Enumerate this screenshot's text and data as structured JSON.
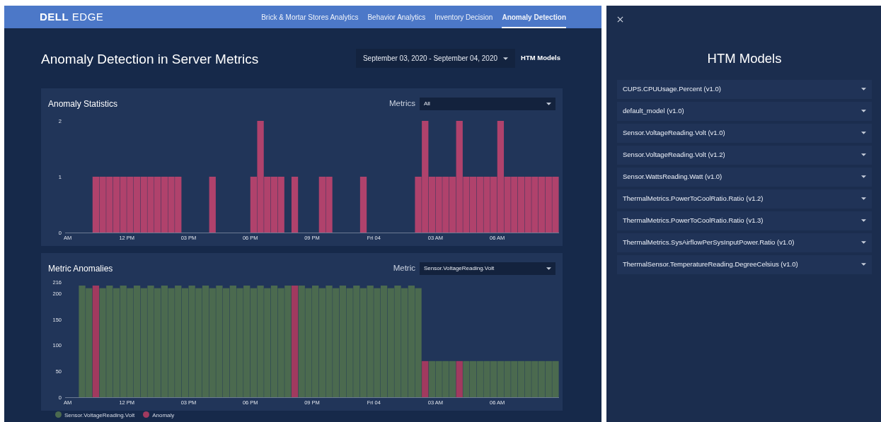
{
  "navbar": {
    "logo": {
      "brand": "DELL",
      "product": "EDGE"
    },
    "links": [
      {
        "label": "Brick & Mortar Stores Analytics",
        "selected": false
      },
      {
        "label": "Behavior Analytics",
        "selected": false
      },
      {
        "label": "Inventory Decision",
        "selected": false
      },
      {
        "label": "Anomaly Detection",
        "selected": true
      }
    ]
  },
  "page_title": "Anomaly Detection in Server Metrics",
  "date_range": {
    "value": "September 03, 2020 - September 04, 2020"
  },
  "htm_models_button": "HTM Models",
  "cards": [
    {
      "title": "Anomaly Statistics",
      "filter": {
        "label": "Metrics",
        "value": "All"
      },
      "chart_data": {
        "type": "bar",
        "categories": [
          "AM",
          null,
          null,
          null,
          null,
          null,
          null,
          null,
          null,
          "12 PM",
          null,
          null,
          null,
          null,
          null,
          null,
          null,
          null,
          "03 PM",
          null,
          null,
          null,
          null,
          null,
          null,
          null,
          null,
          "06 PM",
          null,
          null,
          null,
          null,
          null,
          null,
          null,
          null,
          "09 PM",
          null,
          null,
          null,
          null,
          null,
          null,
          null,
          null,
          "Fri 04",
          null,
          null,
          null,
          null,
          null,
          null,
          null,
          null,
          "03 AM",
          null,
          null,
          null,
          null,
          null,
          null,
          null,
          null,
          "06 AM",
          null,
          null,
          null,
          null,
          null,
          null,
          null,
          null
        ],
        "values": [
          0,
          0,
          0,
          0,
          1,
          1,
          1,
          1,
          1,
          1,
          1,
          1,
          1,
          1,
          1,
          1,
          1,
          0,
          0,
          0,
          0,
          1,
          0,
          0,
          0,
          0,
          0,
          1,
          2,
          1,
          1,
          1,
          0,
          1,
          0,
          0,
          0,
          1,
          1,
          0,
          0,
          0,
          0,
          1,
          0,
          0,
          0,
          0,
          0,
          0,
          0,
          1,
          2,
          1,
          1,
          1,
          1,
          2,
          1,
          1,
          1,
          1,
          1,
          2,
          1,
          1,
          1,
          1,
          1,
          1,
          1,
          1
        ],
        "ylim": [
          0,
          2
        ],
        "yticks": [
          0,
          1,
          2
        ]
      }
    },
    {
      "title": "Metric Anomalies",
      "filter": {
        "label": "Metric",
        "value": "Sensor.VoltageReading.Volt"
      },
      "chart_data": {
        "type": "bar",
        "categories": [
          "AM",
          null,
          null,
          null,
          null,
          null,
          null,
          null,
          null,
          "12 PM",
          null,
          null,
          null,
          null,
          null,
          null,
          null,
          null,
          "03 PM",
          null,
          null,
          null,
          null,
          null,
          null,
          null,
          null,
          "06 PM",
          null,
          null,
          null,
          null,
          null,
          null,
          null,
          null,
          "09 PM",
          null,
          null,
          null,
          null,
          null,
          null,
          null,
          null,
          "Fri 04",
          null,
          null,
          null,
          null,
          null,
          null,
          null,
          null,
          "03 AM",
          null,
          null,
          null,
          null,
          null,
          null,
          null,
          null,
          "06 AM",
          null,
          null,
          null,
          null,
          null,
          null,
          null,
          null
        ],
        "series": [
          {
            "name": "Sensor.VoltageReading.Volt",
            "color": "#4b6a4f",
            "values": [
              null,
              null,
              216,
              211,
              null,
              211,
              216,
              211,
              216,
              211,
              216,
              211,
              216,
              211,
              216,
              211,
              216,
              211,
              216,
              211,
              216,
              211,
              216,
              211,
              216,
              211,
              216,
              211,
              216,
              211,
              216,
              211,
              216,
              null,
              216,
              211,
              216,
              211,
              216,
              211,
              216,
              211,
              216,
              211,
              216,
              211,
              216,
              211,
              216,
              211,
              216,
              211,
              null,
              70,
              70,
              70,
              70,
              null,
              70,
              70,
              70,
              70,
              70,
              70,
              70,
              70,
              70,
              70,
              70,
              70,
              70,
              70
            ]
          },
          {
            "name": "Anomaly",
            "color": "#a13a5f",
            "values": [
              null,
              null,
              null,
              null,
              216,
              null,
              null,
              null,
              null,
              null,
              null,
              null,
              null,
              null,
              null,
              null,
              null,
              null,
              null,
              null,
              null,
              null,
              null,
              null,
              null,
              null,
              null,
              null,
              null,
              null,
              null,
              null,
              null,
              216,
              null,
              null,
              null,
              null,
              null,
              null,
              null,
              null,
              null,
              null,
              null,
              null,
              null,
              null,
              null,
              null,
              null,
              null,
              70,
              null,
              null,
              null,
              null,
              70,
              null,
              null,
              null,
              null,
              null,
              null,
              null,
              null,
              null,
              null,
              null,
              null,
              null,
              null
            ]
          }
        ],
        "ylim": [
          0,
          216
        ],
        "yticks": [
          0,
          50,
          100,
          150,
          200,
          216
        ]
      }
    }
  ],
  "htm_models_panel": {
    "title": "HTM Models",
    "models": [
      {
        "label": "CUPS.CPUUsage.Percent (v1.0)",
        "expanded": false
      },
      {
        "label": "default_model (v1.0)",
        "expanded": false
      },
      {
        "label": "Sensor.VoltageReading.Volt (v1.0)",
        "expanded": false
      },
      {
        "label": "Sensor.VoltageReading.Volt (v1.2)",
        "expanded": false
      },
      {
        "label": "Sensor.WattsReading.Watt (v1.0)",
        "expanded": false
      },
      {
        "label": "ThermalMetrics.PowerToCoolRatio.Ratio (v1.2)",
        "expanded": false
      },
      {
        "label": "ThermalMetrics.PowerToCoolRatio.Ratio (v1.3)",
        "expanded": false
      },
      {
        "label": "ThermalMetrics.SysAirflowPerSysInputPower.Ratio (v1.0)",
        "expanded": false
      },
      {
        "label": "ThermalSensor.TemperatureReading.DegreeCelsius (v1.0)",
        "expanded": false
      }
    ]
  }
}
